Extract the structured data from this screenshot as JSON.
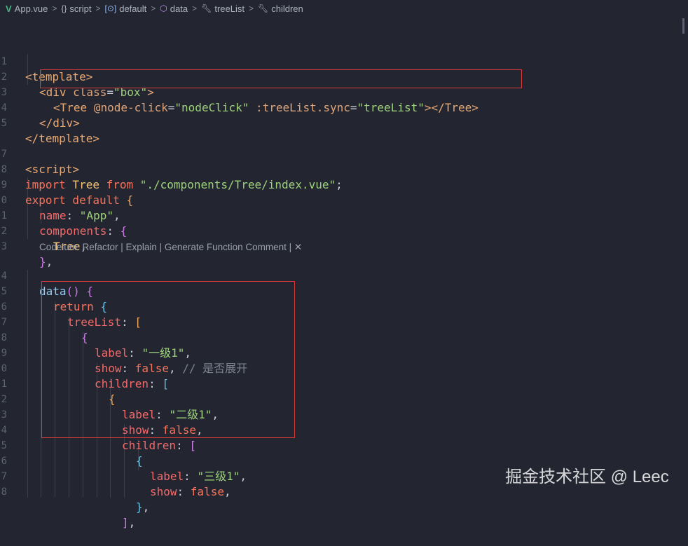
{
  "breadcrumb": {
    "file": "App.vue",
    "script": "script",
    "default": "default",
    "data": "data",
    "treeList": "treeList",
    "children": "children"
  },
  "codelens": "Codeium: Refactor | Explain | Generate Function Comment | ✕",
  "watermark": "掘金技术社区 @ Leec",
  "line_numbers": [
    "1",
    "2",
    "3",
    "4",
    "5",
    "",
    "7",
    "8",
    "9",
    "0",
    "1",
    "2",
    "3",
    "",
    "4",
    "5",
    "6",
    "7",
    "8",
    "9",
    "0",
    "1",
    "2",
    "3",
    "4",
    "5",
    "6",
    "7",
    "8"
  ],
  "code": {
    "l1_tag": "<template>",
    "l2_open": "<div",
    "l2_attr": " class",
    "l2_eq": "=",
    "l2_val": "\"box\"",
    "l2_close": ">",
    "l3_open": "<Tree",
    "l3_attr1": " @node-click",
    "l3_eq1": "=",
    "l3_val1": "\"nodeClick\"",
    "l3_attr2": " :treeList.sync",
    "l3_eq2": "=",
    "l3_val2": "\"treeList\"",
    "l3_close": "></Tree>",
    "l4": "</div>",
    "l5": "</template>",
    "l7": "<script>",
    "l8_kw1": "import",
    "l8_id": " Tree ",
    "l8_kw2": "from",
    "l8_str": " \"./components/Tree/index.vue\"",
    "l8_semi": ";",
    "l9_kw1": "export",
    "l9_kw2": " default",
    "l9_br": " {",
    "l10_key": "name",
    "l10_colon": ": ",
    "l10_val": "\"App\"",
    "l10_comma": ",",
    "l11_key": "components",
    "l11_colon": ": ",
    "l11_br": "{",
    "l12_id": "Tree",
    "l12_comma": ",",
    "l13_br": "}",
    "l13_comma": ",",
    "l14_fn": "data",
    "l14_paren": "()",
    "l14_br": " {",
    "l15_kw": "return",
    "l15_br": " {",
    "l16_key": "treeList",
    "l16_colon": ": ",
    "l16_br": "[",
    "l17_br": "{",
    "l18_key": "label",
    "l18_colon": ": ",
    "l18_val": "\"一级1\"",
    "l18_comma": ",",
    "l19_key": "show",
    "l19_colon": ": ",
    "l19_val": "false",
    "l19_comma": ", ",
    "l19_cm": "// 是否展开",
    "l20_key": "children",
    "l20_colon": ": ",
    "l20_br": "[",
    "l21_br": "{",
    "l22_key": "label",
    "l22_colon": ": ",
    "l22_val": "\"二级1\"",
    "l22_comma": ",",
    "l23_key": "show",
    "l23_colon": ": ",
    "l23_val": "false",
    "l23_comma": ",",
    "l24_key": "children",
    "l24_colon": ": ",
    "l24_br": "[",
    "l25_br": "{",
    "l26_key": "label",
    "l26_colon": ": ",
    "l26_val": "\"三级1\"",
    "l26_comma": ",",
    "l27_key": "show",
    "l27_colon": ": ",
    "l27_val": "false",
    "l27_comma": ",",
    "l28_br": "}",
    "l28_comma": ",",
    "l29_br": "]",
    "l29_comma": ","
  }
}
